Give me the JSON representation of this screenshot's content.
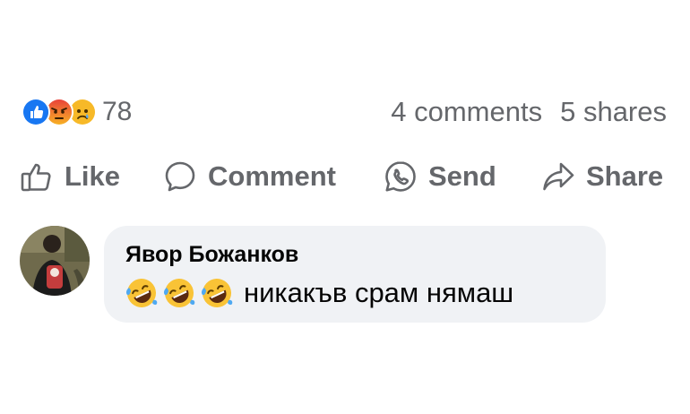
{
  "post_stats": {
    "reactions": [
      "like",
      "angry",
      "sad"
    ],
    "reaction_count": "78",
    "comments": "4 comments",
    "shares": "5 shares"
  },
  "actions": {
    "like_label": "Like",
    "comment_label": "Comment",
    "send_label": "Send",
    "share_label": "Share"
  },
  "comment": {
    "author": "Явор Божанков",
    "emojis": [
      "rolling-on-floor-laughing",
      "rolling-on-floor-laughing",
      "rolling-on-floor-laughing"
    ],
    "text": "никакъв срам нямаш"
  },
  "colors": {
    "text_secondary": "#65676b",
    "text_primary": "#050505",
    "bubble_bg": "#f0f2f5",
    "like_blue": "#1877f2"
  }
}
